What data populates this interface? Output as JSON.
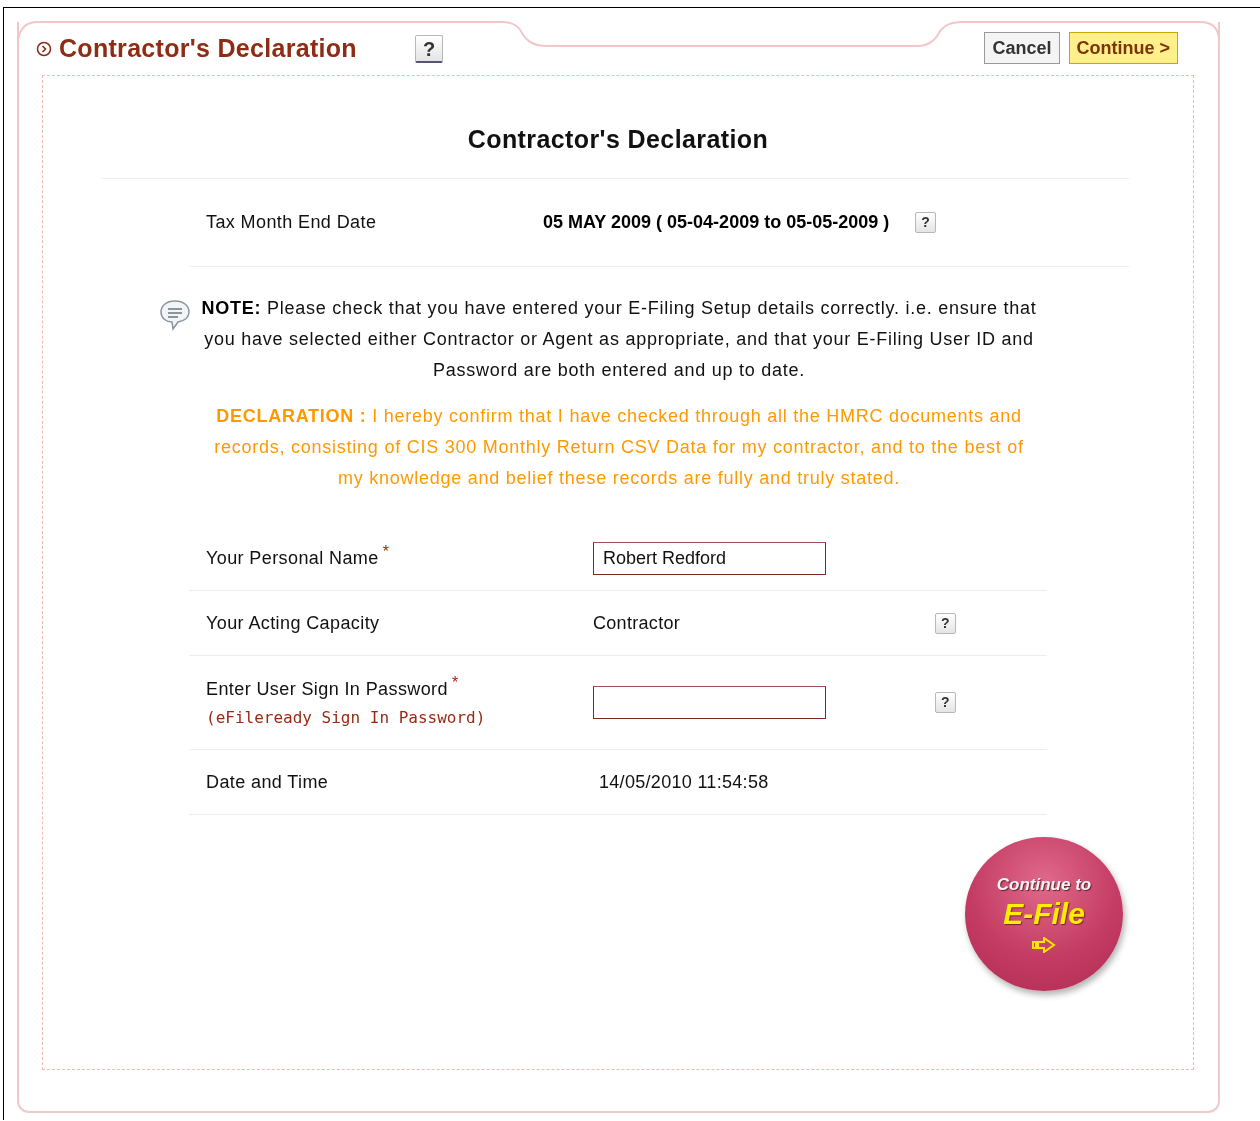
{
  "header": {
    "title": "Contractor's Declaration",
    "help": "?",
    "buttons": [
      {
        "label": "Cancel",
        "kind": "plain"
      },
      {
        "label": "Continue >",
        "kind": "primary"
      }
    ]
  },
  "form": {
    "title": "Contractor's Declaration",
    "tax_month": {
      "label": "Tax Month End Date",
      "value": "05 MAY 2009 ( 05-04-2009 to 05-05-2009 )",
      "help": "?"
    },
    "note": "**NOTE:** Please check that you have entered your E-Filing Setup details correctly. i.e. ensure that you have selected either Contractor or Agent as appropriate, and that your E-Filing User ID and Password are both entered and up to date.",
    "declaration": "**DECLARATION :** I hereby confirm that I have checked through all the HMRC documents and records, consisting of CIS 300 Monthly Return CSV Data for my contractor, and to the best of my knowledge and belief these records are fully and truly stated.",
    "fields": [
      {
        "kind": "input",
        "label": "Your Personal Name",
        "required_mark": "*",
        "value": "Robert Redford"
      },
      {
        "kind": "text",
        "label": "Your Acting Capacity",
        "value": "Contractor",
        "help": "?"
      },
      {
        "kind": "input",
        "label": "Enter User Sign In Password",
        "required_mark": "*",
        "sublabel": "(eFileready Sign In Password)",
        "help": "?"
      },
      {
        "kind": "text",
        "label": "Date and Time",
        "value": "14/05/2010 11:54:58"
      }
    ],
    "efile_button": {
      "line1": "Continue to",
      "line2": "E-File"
    }
  }
}
